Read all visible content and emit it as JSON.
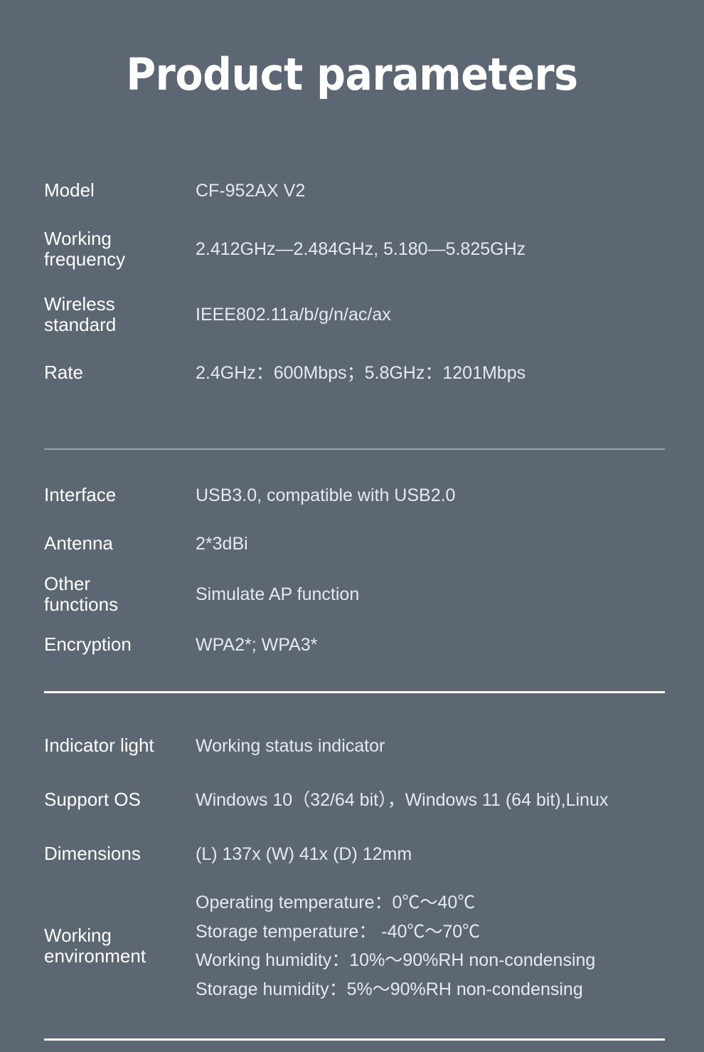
{
  "page": {
    "title": "Product parameters",
    "background_color": "#5d6673",
    "label_color": "#ffffff",
    "value_color": "#e6eaee"
  },
  "sections": [
    {
      "id": "section-one",
      "rows": [
        {
          "label": "Model",
          "value": "CF-952AX V2"
        },
        {
          "label": "Working\nfrequency",
          "value": "2.412GHz—2.484GHz,  5.180—5.825GHz"
        },
        {
          "label": "Wireless\nstandard",
          "value": "IEEE802.11a/b/g/n/ac/ax"
        },
        {
          "label": "Rate",
          "value": "2.4GHz：600Mbps；5.8GHz：1201Mbps"
        }
      ]
    },
    {
      "id": "section-two",
      "rows": [
        {
          "label": "Interface",
          "value": "USB3.0, compatible with USB2.0"
        },
        {
          "label": "Antenna",
          "value": "2*3dBi"
        },
        {
          "label": "Other\nfunctions",
          "value": "Simulate AP function"
        },
        {
          "label": "Encryption",
          "value": "WPA2*; WPA3*"
        }
      ]
    },
    {
      "id": "section-three",
      "rows": [
        {
          "label": "Indicator light",
          "value": "Working status indicator"
        },
        {
          "label": "Support OS",
          "value": "Windows 10（32/64 bit），Windows 11 (64 bit),Linux"
        },
        {
          "label": "Dimensions",
          "value": "(L) 137x (W) 41x (D) 12mm"
        },
        {
          "label": "Working\nenvironment",
          "value": "Operating temperature：0℃〜40℃\nStorage temperature： -40℃〜70℃\nWorking humidity：10%〜90%RH non-condensing\nStorage humidity：5%〜90%RH non-condensing"
        }
      ]
    }
  ],
  "dividers": [
    {
      "name": "divider-after-rate",
      "color": "#9aa3ae"
    },
    {
      "name": "divider-after-encryption",
      "color": "#ffffff"
    },
    {
      "name": "divider-bottom",
      "color": "#ffffff"
    }
  ]
}
